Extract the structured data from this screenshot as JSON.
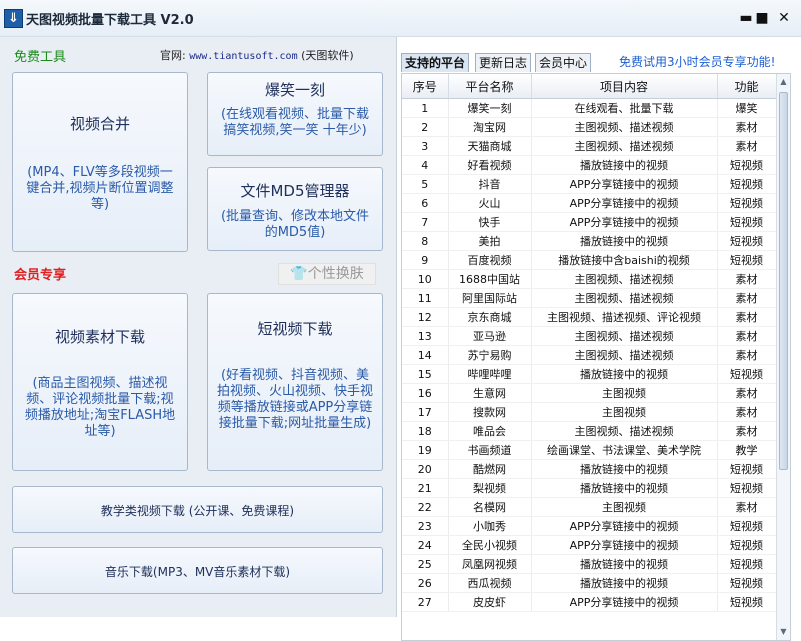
{
  "window": {
    "title": "天图视频批量下载工具 V2.0",
    "icon_name": "download-app-icon",
    "minimize_label": "▬",
    "maximize_label": "■",
    "close_label": "✕"
  },
  "left": {
    "free_tools_label": "免费工具",
    "official_prefix": "官网:",
    "official_url": "www.tiantusoft.com",
    "official_suffix": "(天图软件)",
    "member_label": "会员专享",
    "skin_label": "👕个性换肤",
    "cards": {
      "video_merge": {
        "title": "视频合并",
        "desc": "(MP4、FLV等多段视频一键合并,视频片断位置调整等)"
      },
      "baoxiao": {
        "title": "爆笑一刻",
        "desc": "(在线观看视频、批量下载搞笑视频,笑一笑 十年少)"
      },
      "md5": {
        "title": "文件MD5管理器",
        "desc": "(批量查询、修改本地文件的MD5值)"
      },
      "material": {
        "title": "视频素材下载",
        "desc": "(商品主图视频、描述视频、评论视频批量下载;视频播放地址;淘宝FLASH地址等)"
      },
      "short_video": {
        "title": "短视频下载",
        "desc": "(好看视频、抖音视频、美拍视频、火山视频、快手视频等播放链接或APP分享链接批量下载;网址批量生成)"
      },
      "education": {
        "title": "教学类视频下载 (公开课、免费课程)"
      },
      "music": {
        "title": "音乐下载(MP3、MV音乐素材下载)"
      }
    }
  },
  "right": {
    "tabs": [
      "支持的平台",
      "更新日志",
      "会员中心"
    ],
    "promo": "免费试用3小时会员专享功能!",
    "columns": [
      "序号",
      "平台名称",
      "项目内容",
      "功能"
    ],
    "rows": [
      [
        "1",
        "爆笑一刻",
        "在线观看、批量下载",
        "爆笑"
      ],
      [
        "2",
        "淘宝网",
        "主图视频、描述视频",
        "素材"
      ],
      [
        "3",
        "天猫商城",
        "主图视频、描述视频",
        "素材"
      ],
      [
        "4",
        "好看视频",
        "播放链接中的视频",
        "短视频"
      ],
      [
        "5",
        "抖音",
        "APP分享链接中的视频",
        "短视频"
      ],
      [
        "6",
        "火山",
        "APP分享链接中的视频",
        "短视频"
      ],
      [
        "7",
        "快手",
        "APP分享链接中的视频",
        "短视频"
      ],
      [
        "8",
        "美拍",
        "播放链接中的视频",
        "短视频"
      ],
      [
        "9",
        "百度视频",
        "播放链接中含baishi的视频",
        "短视频"
      ],
      [
        "10",
        "1688中国站",
        "主图视频、描述视频",
        "素材"
      ],
      [
        "11",
        "阿里国际站",
        "主图视频、描述视频",
        "素材"
      ],
      [
        "12",
        "京东商城",
        "主图视频、描述视频、评论视频",
        "素材"
      ],
      [
        "13",
        "亚马逊",
        "主图视频、描述视频",
        "素材"
      ],
      [
        "14",
        "苏宁易购",
        "主图视频、描述视频",
        "素材"
      ],
      [
        "15",
        "哔哩哔哩",
        "播放链接中的视频",
        "短视频"
      ],
      [
        "16",
        "生意网",
        "主图视频",
        "素材"
      ],
      [
        "17",
        "搜款网",
        "主图视频",
        "素材"
      ],
      [
        "18",
        "唯品会",
        "主图视频、描述视频",
        "素材"
      ],
      [
        "19",
        "书画频道",
        "绘画课堂、书法课堂、美术学院",
        "教学"
      ],
      [
        "20",
        "酷燃网",
        "播放链接中的视频",
        "短视频"
      ],
      [
        "21",
        "梨视频",
        "播放链接中的视频",
        "短视频"
      ],
      [
        "22",
        "名模网",
        "主图视频",
        "素材"
      ],
      [
        "23",
        "小咖秀",
        "APP分享链接中的视频",
        "短视频"
      ],
      [
        "24",
        "全民小视频",
        "APP分享链接中的视频",
        "短视频"
      ],
      [
        "25",
        "凤凰网视频",
        "播放链接中的视频",
        "短视频"
      ],
      [
        "26",
        "西瓜视频",
        "播放链接中的视频",
        "短视频"
      ],
      [
        "27",
        "皮皮虾",
        "APP分享链接中的视频",
        "短视频"
      ]
    ]
  }
}
